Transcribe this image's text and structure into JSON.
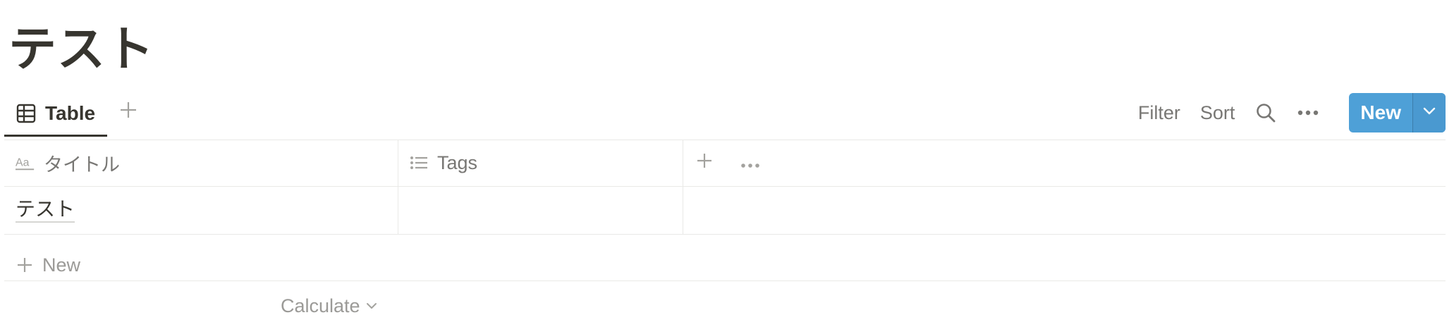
{
  "page": {
    "title": "テスト"
  },
  "views": {
    "tabs": [
      {
        "label": "Table",
        "icon": "table-icon",
        "active": true
      }
    ],
    "add_icon": "plus-icon"
  },
  "toolbar": {
    "filter_label": "Filter",
    "sort_label": "Sort",
    "search_icon": "search-icon",
    "more_icon": "ellipsis-icon",
    "new_label": "New",
    "new_dropdown_icon": "chevron-down-icon",
    "accent": "#4ea0d7"
  },
  "table": {
    "columns": [
      {
        "label": "タイトル",
        "icon": "text-property-icon"
      },
      {
        "label": "Tags",
        "icon": "list-icon"
      }
    ],
    "add_column_icon": "plus-icon",
    "column_more_icon": "ellipsis-icon",
    "rows": [
      {
        "title": "テスト",
        "tags": ""
      }
    ],
    "new_row_label": "New",
    "calculate_label": "Calculate"
  }
}
